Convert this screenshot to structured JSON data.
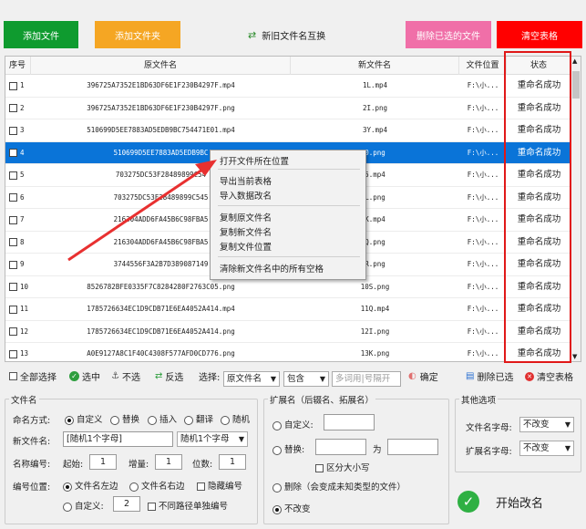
{
  "toolbar": {
    "add_file": "添加文件",
    "add_folder": "添加文件夹",
    "swap_names": "新旧文件名互换",
    "delete_selected": "删除已选的文件",
    "clear_table": "清空表格"
  },
  "colors": {
    "green": "#0f9b2f",
    "orange": "#f5a623",
    "pink": "#f06fa8",
    "red": "#ff0000",
    "selected_row": "#0a74d8"
  },
  "table": {
    "headers": [
      "序号",
      "原文件名",
      "新文件名",
      "文件位置",
      "状态"
    ],
    "rows": [
      {
        "no": "1",
        "orig": "396725A7352E1BD63DF6E1F230B4297F.mp4",
        "new": "1L.mp4",
        "loc": "F:\\小...",
        "status": "重命名成功"
      },
      {
        "no": "2",
        "orig": "396725A7352E1BD63DF6E1F230B4297F.png",
        "new": "2I.png",
        "loc": "F:\\小...",
        "status": "重命名成功"
      },
      {
        "no": "3",
        "orig": "510699D5EE7883AD5EDB9BC754471E01.mp4",
        "new": "3Y.mp4",
        "loc": "F:\\小...",
        "status": "重命名成功"
      },
      {
        "no": "4",
        "orig": "510699D5EE7883AD5EDB9BC",
        "new": "0.png",
        "loc": "F:\\小...",
        "status": "重命名成功"
      },
      {
        "no": "5",
        "orig": "703275DC53F28489899C54",
        "new": "5.mp4",
        "loc": "F:\\小...",
        "status": "重命名成功"
      },
      {
        "no": "6",
        "orig": "703275DC53F28489899C545",
        "new": "L.png",
        "loc": "F:\\小...",
        "status": "重命名成功"
      },
      {
        "no": "7",
        "orig": "216304ADD6FA45B6C98FBA5",
        "new": "K.mp4",
        "loc": "F:\\小...",
        "status": "重命名成功"
      },
      {
        "no": "8",
        "orig": "216304ADD6FA45B6C98FBA5",
        "new": "Q.png",
        "loc": "F:\\小...",
        "status": "重命名成功"
      },
      {
        "no": "9",
        "orig": "3744556F3A2B7D389087149",
        "new": "R.png",
        "loc": "F:\\小...",
        "status": "重命名成功"
      },
      {
        "no": "10",
        "orig": "8526782BFE0335F7C8284280F2763C05.png",
        "new": "10S.png",
        "loc": "F:\\小...",
        "status": "重命名成功"
      },
      {
        "no": "11",
        "orig": "1785726634EC1D9CDB71E6EA4052A414.mp4",
        "new": "11Q.mp4",
        "loc": "F:\\小...",
        "status": "重命名成功"
      },
      {
        "no": "12",
        "orig": "1785726634EC1D9CDB71E6EA4052A414.png",
        "new": "12I.png",
        "loc": "F:\\小...",
        "status": "重命名成功"
      },
      {
        "no": "13",
        "orig": "A0E9127A8C1F40C4308F577AFD0CD776.png",
        "new": "13K.png",
        "loc": "F:\\小...",
        "status": "重命名成功"
      }
    ]
  },
  "context_menu": {
    "items": [
      "打开文件所在位置",
      "导出当前表格",
      "导入数据改名",
      "复制原文件名",
      "复制新文件名",
      "复制文件位置",
      "清除新文件名中的所有空格"
    ]
  },
  "select_bar": {
    "select_all": "全部选择",
    "check": "选中",
    "uncheck": "不选",
    "invert": "反选",
    "select_label": "选择:",
    "field_value": "原文件名",
    "op_value": "包含",
    "keyword_placeholder": "多词用|号隔开",
    "confirm": "确定",
    "delete_checked": "删除已选",
    "clear_table": "清空表格"
  },
  "filename_group": {
    "title": "文件名",
    "mode_label": "命名方式:",
    "modes": [
      "自定义",
      "替换",
      "插入",
      "翻译",
      "随机"
    ],
    "new_name_label": "新文件名:",
    "new_name_value": "[随机1个字母]",
    "random_select": "随机1个字母",
    "number_label": "名称编号:",
    "start_label": "起始:",
    "start_value": "1",
    "step_label": "增量:",
    "step_value": "1",
    "digits_label": "位数:",
    "digits_value": "1",
    "pos_label": "编号位置:",
    "pos_left": "文件名左边",
    "pos_right": "文件名右边",
    "hide_number": "隐藏编号",
    "pos_custom": "自定义:",
    "pos_custom_value": "2",
    "separate_numbering": "不同路径单独编号"
  },
  "ext_group": {
    "title": "扩展名（后辍名、拓展名）",
    "custom": "自定义:",
    "replace": "替换:",
    "to": "为",
    "case": "区分大小写",
    "delete": "删除（会变成未知类型的文件）",
    "unchanged": "不改变"
  },
  "other_group": {
    "title": "其他选项",
    "filename_case_label": "文件名字母:",
    "filename_case_value": "不改变",
    "ext_case_label": "扩展名字母:",
    "ext_case_value": "不改变"
  },
  "start_button": "开始改名"
}
